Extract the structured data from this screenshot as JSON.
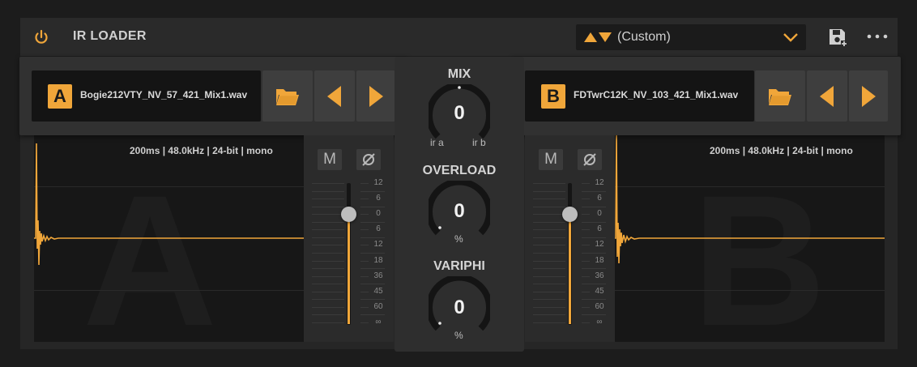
{
  "header": {
    "title": "IR LOADER",
    "preset_name": "(Custom)",
    "accent": "#f0a63a"
  },
  "loader_a": {
    "badge": "A",
    "filename": "Bogie212VTY_NV_57_421_Mix1.wav",
    "meta": "200ms | 48.0kHz | 24-bit | mono",
    "watermark": "A"
  },
  "loader_b": {
    "badge": "B",
    "filename": "FDTwrC12K_NV_103_421_Mix1.wav",
    "meta": "200ms | 48.0kHz | 24-bit | mono",
    "watermark": "B"
  },
  "fader_a": {
    "mute_label": "M",
    "gain_db": 0
  },
  "fader_b": {
    "mute_label": "M",
    "gain_db": 0
  },
  "fader_scale": [
    "12",
    "6",
    "0",
    "6",
    "12",
    "18",
    "36",
    "45",
    "60",
    "∞"
  ],
  "center": {
    "mix": {
      "label": "MIX",
      "value": "0",
      "left": "ir a",
      "right": "ir b"
    },
    "overload": {
      "label": "OVERLOAD",
      "value": "0",
      "unit": "%"
    },
    "variphi": {
      "label": "VARIPHI",
      "value": "0",
      "unit": "%"
    }
  }
}
